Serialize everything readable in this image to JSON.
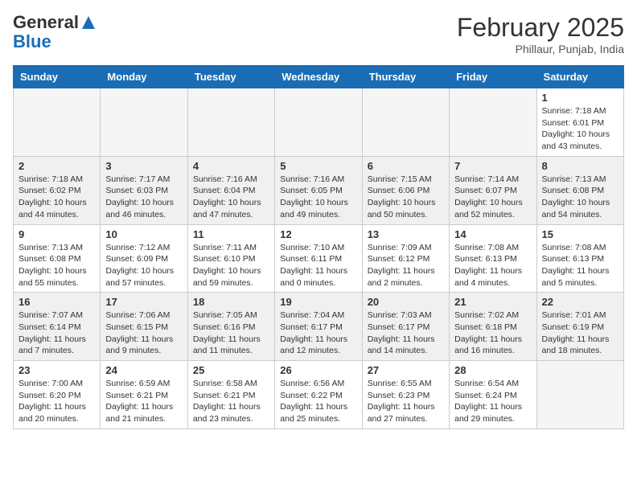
{
  "header": {
    "logo_general": "General",
    "logo_blue": "Blue",
    "month_year": "February 2025",
    "location": "Phillaur, Punjab, India"
  },
  "days_of_week": [
    "Sunday",
    "Monday",
    "Tuesday",
    "Wednesday",
    "Thursday",
    "Friday",
    "Saturday"
  ],
  "weeks": [
    {
      "shade": false,
      "days": [
        {
          "num": "",
          "info": ""
        },
        {
          "num": "",
          "info": ""
        },
        {
          "num": "",
          "info": ""
        },
        {
          "num": "",
          "info": ""
        },
        {
          "num": "",
          "info": ""
        },
        {
          "num": "",
          "info": ""
        },
        {
          "num": "1",
          "info": "Sunrise: 7:18 AM\nSunset: 6:01 PM\nDaylight: 10 hours and 43 minutes."
        }
      ]
    },
    {
      "shade": true,
      "days": [
        {
          "num": "2",
          "info": "Sunrise: 7:18 AM\nSunset: 6:02 PM\nDaylight: 10 hours and 44 minutes."
        },
        {
          "num": "3",
          "info": "Sunrise: 7:17 AM\nSunset: 6:03 PM\nDaylight: 10 hours and 46 minutes."
        },
        {
          "num": "4",
          "info": "Sunrise: 7:16 AM\nSunset: 6:04 PM\nDaylight: 10 hours and 47 minutes."
        },
        {
          "num": "5",
          "info": "Sunrise: 7:16 AM\nSunset: 6:05 PM\nDaylight: 10 hours and 49 minutes."
        },
        {
          "num": "6",
          "info": "Sunrise: 7:15 AM\nSunset: 6:06 PM\nDaylight: 10 hours and 50 minutes."
        },
        {
          "num": "7",
          "info": "Sunrise: 7:14 AM\nSunset: 6:07 PM\nDaylight: 10 hours and 52 minutes."
        },
        {
          "num": "8",
          "info": "Sunrise: 7:13 AM\nSunset: 6:08 PM\nDaylight: 10 hours and 54 minutes."
        }
      ]
    },
    {
      "shade": false,
      "days": [
        {
          "num": "9",
          "info": "Sunrise: 7:13 AM\nSunset: 6:08 PM\nDaylight: 10 hours and 55 minutes."
        },
        {
          "num": "10",
          "info": "Sunrise: 7:12 AM\nSunset: 6:09 PM\nDaylight: 10 hours and 57 minutes."
        },
        {
          "num": "11",
          "info": "Sunrise: 7:11 AM\nSunset: 6:10 PM\nDaylight: 10 hours and 59 minutes."
        },
        {
          "num": "12",
          "info": "Sunrise: 7:10 AM\nSunset: 6:11 PM\nDaylight: 11 hours and 0 minutes."
        },
        {
          "num": "13",
          "info": "Sunrise: 7:09 AM\nSunset: 6:12 PM\nDaylight: 11 hours and 2 minutes."
        },
        {
          "num": "14",
          "info": "Sunrise: 7:08 AM\nSunset: 6:13 PM\nDaylight: 11 hours and 4 minutes."
        },
        {
          "num": "15",
          "info": "Sunrise: 7:08 AM\nSunset: 6:13 PM\nDaylight: 11 hours and 5 minutes."
        }
      ]
    },
    {
      "shade": true,
      "days": [
        {
          "num": "16",
          "info": "Sunrise: 7:07 AM\nSunset: 6:14 PM\nDaylight: 11 hours and 7 minutes."
        },
        {
          "num": "17",
          "info": "Sunrise: 7:06 AM\nSunset: 6:15 PM\nDaylight: 11 hours and 9 minutes."
        },
        {
          "num": "18",
          "info": "Sunrise: 7:05 AM\nSunset: 6:16 PM\nDaylight: 11 hours and 11 minutes."
        },
        {
          "num": "19",
          "info": "Sunrise: 7:04 AM\nSunset: 6:17 PM\nDaylight: 11 hours and 12 minutes."
        },
        {
          "num": "20",
          "info": "Sunrise: 7:03 AM\nSunset: 6:17 PM\nDaylight: 11 hours and 14 minutes."
        },
        {
          "num": "21",
          "info": "Sunrise: 7:02 AM\nSunset: 6:18 PM\nDaylight: 11 hours and 16 minutes."
        },
        {
          "num": "22",
          "info": "Sunrise: 7:01 AM\nSunset: 6:19 PM\nDaylight: 11 hours and 18 minutes."
        }
      ]
    },
    {
      "shade": false,
      "days": [
        {
          "num": "23",
          "info": "Sunrise: 7:00 AM\nSunset: 6:20 PM\nDaylight: 11 hours and 20 minutes."
        },
        {
          "num": "24",
          "info": "Sunrise: 6:59 AM\nSunset: 6:21 PM\nDaylight: 11 hours and 21 minutes."
        },
        {
          "num": "25",
          "info": "Sunrise: 6:58 AM\nSunset: 6:21 PM\nDaylight: 11 hours and 23 minutes."
        },
        {
          "num": "26",
          "info": "Sunrise: 6:56 AM\nSunset: 6:22 PM\nDaylight: 11 hours and 25 minutes."
        },
        {
          "num": "27",
          "info": "Sunrise: 6:55 AM\nSunset: 6:23 PM\nDaylight: 11 hours and 27 minutes."
        },
        {
          "num": "28",
          "info": "Sunrise: 6:54 AM\nSunset: 6:24 PM\nDaylight: 11 hours and 29 minutes."
        },
        {
          "num": "",
          "info": ""
        }
      ]
    }
  ]
}
